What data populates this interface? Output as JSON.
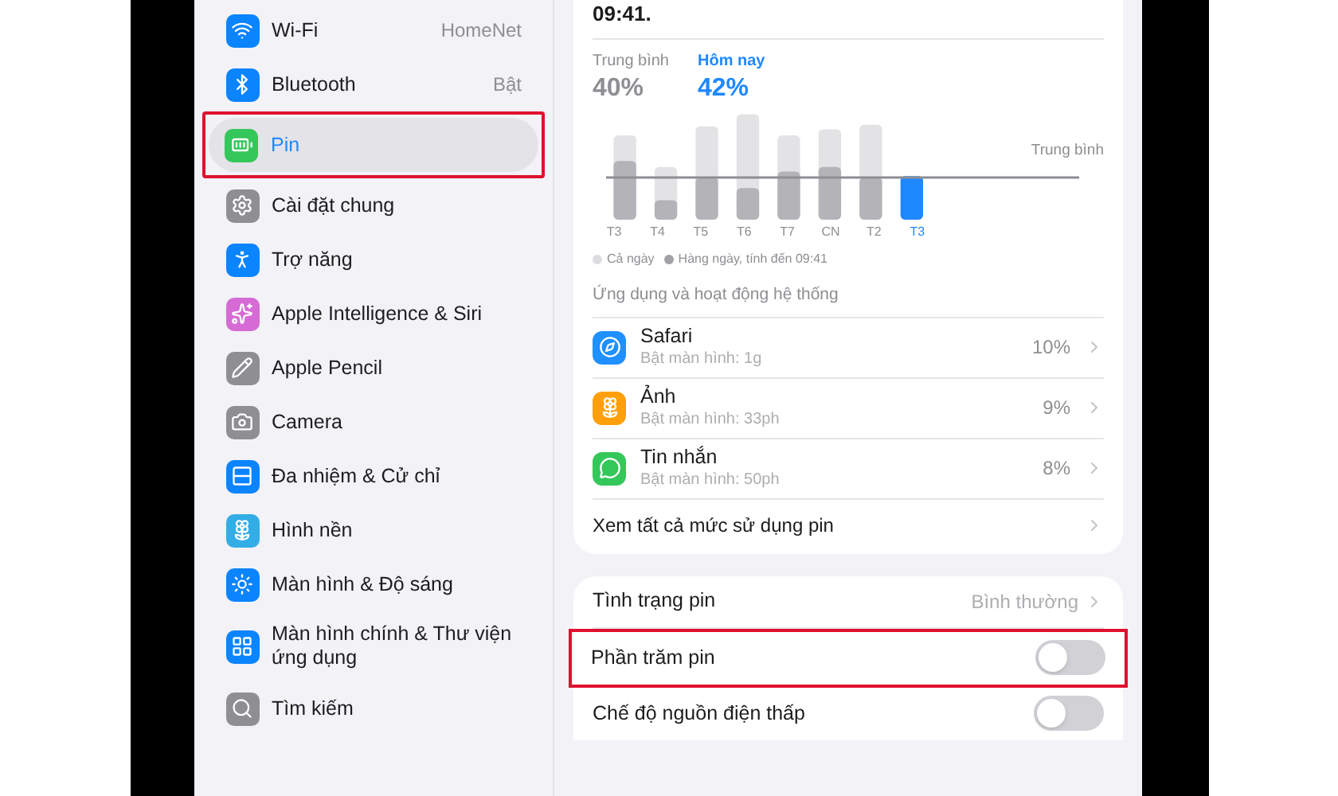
{
  "sidebar": {
    "items": [
      {
        "label": "Wi-Fi",
        "value": "HomeNet",
        "kind": "wifi",
        "selected": false,
        "highlighted": false
      },
      {
        "label": "Bluetooth",
        "value": "Bật",
        "kind": "bluetooth",
        "selected": false,
        "highlighted": false
      },
      {
        "label": "Pin",
        "kind": "battery",
        "selected": true,
        "highlighted": true
      },
      {
        "label": "Cài đặt chung",
        "kind": "general",
        "selected": false,
        "highlighted": false
      },
      {
        "label": "Trợ năng",
        "kind": "accessibility",
        "selected": false,
        "highlighted": false
      },
      {
        "label": "Apple Intelligence & Siri",
        "kind": "siri",
        "selected": false,
        "highlighted": false
      },
      {
        "label": "Apple Pencil",
        "kind": "pencil",
        "selected": false,
        "highlighted": false
      },
      {
        "label": "Camera",
        "kind": "camera",
        "selected": false,
        "highlighted": false
      },
      {
        "label": "Đa nhiệm & Cử chỉ",
        "kind": "multitask",
        "selected": false,
        "highlighted": false
      },
      {
        "label": "Hình nền",
        "kind": "wallpaper",
        "selected": false,
        "highlighted": false
      },
      {
        "label": "Màn hình & Độ sáng",
        "kind": "display",
        "selected": false,
        "highlighted": false
      },
      {
        "label": "Màn hình chính & Thư viện ứng dụng",
        "kind": "home",
        "selected": false,
        "highlighted": false
      },
      {
        "label": "Tìm kiếm",
        "kind": "search",
        "selected": false,
        "highlighted": false
      }
    ]
  },
  "usage_card": {
    "time": "09:41.",
    "stats": [
      {
        "label": "Trung bình",
        "value": "40%",
        "selected": false
      },
      {
        "label": "Hôm nay",
        "value": "42%",
        "selected": true
      }
    ],
    "chart": {
      "average_label": "Trung bình",
      "days": [
        {
          "label": "T3",
          "selected": false
        },
        {
          "label": "T4",
          "selected": false
        },
        {
          "label": "T5",
          "selected": false
        },
        {
          "label": "T6",
          "selected": false
        },
        {
          "label": "T7",
          "selected": false
        },
        {
          "label": "CN",
          "selected": false
        },
        {
          "label": "T2",
          "selected": false
        },
        {
          "label": "T3",
          "selected": true
        }
      ],
      "legend": [
        "Cả ngày",
        "Hàng ngày, tính đến 09:41"
      ]
    },
    "section_title": "Ứng dụng và hoạt động hệ thống",
    "apps": [
      {
        "name": "Safari",
        "detail": "Bật màn hình: 1g",
        "percent": "10%",
        "kind": "safari"
      },
      {
        "name": "Ảnh",
        "detail": "Bật màn hình: 33ph",
        "percent": "9%",
        "kind": "photos"
      },
      {
        "name": "Tin nhắn",
        "detail": "Bật màn hình: 50ph",
        "percent": "8%",
        "kind": "messages"
      }
    ],
    "see_all": "Xem tất cả mức sử dụng pin"
  },
  "settings_card": {
    "rows": [
      {
        "label": "Tình trạng pin",
        "value": "Bình thường",
        "kind": "link",
        "highlighted": false
      },
      {
        "label": "Phần trăm pin",
        "kind": "toggle",
        "on": false,
        "highlighted": true
      },
      {
        "label": "Chế độ nguồn điện thấp",
        "kind": "toggle",
        "on": false,
        "highlighted": false
      }
    ]
  }
}
